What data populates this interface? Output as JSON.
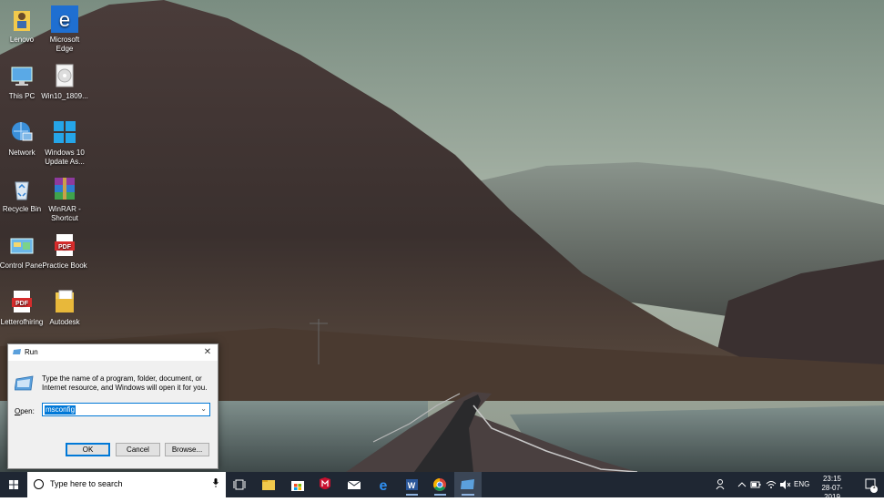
{
  "desktop": {
    "icons": [
      {
        "label": "Lenovo",
        "icon": "user-folder-icon"
      },
      {
        "label": "Microsoft Edge",
        "icon": "edge-icon"
      },
      {
        "label": "This PC",
        "icon": "this-pc-icon"
      },
      {
        "label": "Win10_1809...",
        "icon": "disc-image-icon"
      },
      {
        "label": "Network",
        "icon": "network-icon"
      },
      {
        "label": "Windows 10 Update As...",
        "icon": "windows-update-icon"
      },
      {
        "label": "Recycle Bin",
        "icon": "recycle-bin-icon"
      },
      {
        "label": "WinRAR - Shortcut",
        "icon": "winrar-icon"
      },
      {
        "label": "Control Panel",
        "icon": "control-panel-icon"
      },
      {
        "label": "Practice Book",
        "icon": "pdf-icon"
      },
      {
        "label": "Letterofhiring",
        "icon": "pdf-icon"
      },
      {
        "label": "Autodesk",
        "icon": "folder-icon"
      }
    ]
  },
  "run_dialog": {
    "title": "Run",
    "description": "Type the name of a program, folder, document, or Internet resource, and Windows will open it for you.",
    "open_label_prefix": "",
    "open_label_accel": "O",
    "open_label_rest": "pen:",
    "open_value": "msconfig",
    "ok_label": "OK",
    "cancel_label": "Cancel",
    "browse_label": "Browse...",
    "accent": "#0078d7"
  },
  "taskbar": {
    "search_placeholder": "Type here to search",
    "language": "ENG",
    "time": "23:15",
    "date": "28-07-2019",
    "notification_count": "1",
    "apps": [
      "task-view-icon",
      "file-explorer-icon",
      "store-icon",
      "mcafee-icon",
      "mail-icon",
      "edge-icon",
      "word-icon",
      "chrome-icon",
      "run-icon"
    ],
    "background": "#1f2733"
  }
}
